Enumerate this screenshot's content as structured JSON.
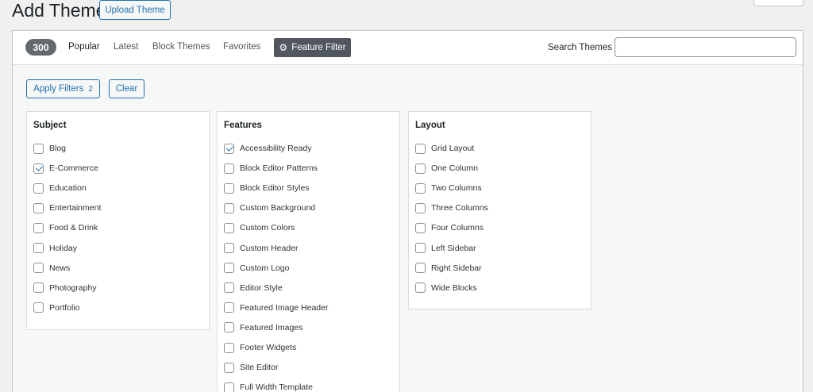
{
  "header": {
    "title": "Add Themes",
    "upload_label": "Upload Theme"
  },
  "filter_bar": {
    "count": "300",
    "links": [
      "Popular",
      "Latest",
      "Block Themes",
      "Favorites"
    ],
    "active_link": "Popular",
    "feature_filter_label": "Feature Filter",
    "search_label": "Search Themes",
    "search_value": ""
  },
  "actions": {
    "apply_label": "Apply Filters",
    "apply_count": "2",
    "clear_label": "Clear"
  },
  "groups": [
    {
      "title": "Subject",
      "options": [
        {
          "label": "Blog",
          "checked": false
        },
        {
          "label": "E-Commerce",
          "checked": true
        },
        {
          "label": "Education",
          "checked": false
        },
        {
          "label": "Entertainment",
          "checked": false
        },
        {
          "label": "Food & Drink",
          "checked": false
        },
        {
          "label": "Holiday",
          "checked": false
        },
        {
          "label": "News",
          "checked": false
        },
        {
          "label": "Photography",
          "checked": false
        },
        {
          "label": "Portfolio",
          "checked": false
        }
      ]
    },
    {
      "title": "Features",
      "options": [
        {
          "label": "Accessibility Ready",
          "checked": true
        },
        {
          "label": "Block Editor Patterns",
          "checked": false
        },
        {
          "label": "Block Editor Styles",
          "checked": false
        },
        {
          "label": "Custom Background",
          "checked": false
        },
        {
          "label": "Custom Colors",
          "checked": false
        },
        {
          "label": "Custom Header",
          "checked": false
        },
        {
          "label": "Custom Logo",
          "checked": false
        },
        {
          "label": "Editor Style",
          "checked": false
        },
        {
          "label": "Featured Image Header",
          "checked": false
        },
        {
          "label": "Featured Images",
          "checked": false
        },
        {
          "label": "Footer Widgets",
          "checked": false
        },
        {
          "label": "Site Editor",
          "checked": false
        },
        {
          "label": "Full Width Template",
          "checked": false
        }
      ]
    },
    {
      "title": "Layout",
      "options": [
        {
          "label": "Grid Layout",
          "checked": false
        },
        {
          "label": "One Column",
          "checked": false
        },
        {
          "label": "Two Columns",
          "checked": false
        },
        {
          "label": "Three Columns",
          "checked": false
        },
        {
          "label": "Four Columns",
          "checked": false
        },
        {
          "label": "Left Sidebar",
          "checked": false
        },
        {
          "label": "Right Sidebar",
          "checked": false
        },
        {
          "label": "Wide Blocks",
          "checked": false
        }
      ]
    }
  ],
  "colors": {
    "accent": "#2271b1",
    "badge": "#646970",
    "feature_filter_bg": "#50575e"
  },
  "icons": {
    "feature_filter": "gear-icon",
    "checked": "checkmark-icon"
  }
}
